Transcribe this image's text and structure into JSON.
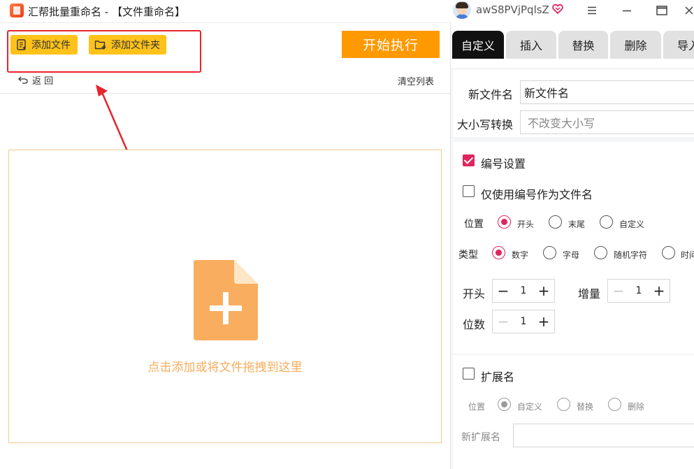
{
  "window": {
    "title": "汇帮批量重命名 - 【文件重命名】",
    "username": "awS8PVjPqlsZ"
  },
  "toolbar": {
    "add_file": "添加文件",
    "add_folder": "添加文件夹",
    "start": "开始执行",
    "back": "返 回",
    "clear_list": "清空列表"
  },
  "dropzone": {
    "text": "点击添加或将文件拖拽到这里"
  },
  "tabs": [
    {
      "label": "自定义",
      "active": true
    },
    {
      "label": "插入"
    },
    {
      "label": "替换"
    },
    {
      "label": "删除"
    },
    {
      "label": "导入"
    }
  ],
  "rename": {
    "new_name_label": "新文件名",
    "new_name_value": "新文件名",
    "case_label": "大小写转换",
    "case_value": "不改变大小写"
  },
  "numbering": {
    "settings_label": "编号设置",
    "settings_checked": true,
    "only_number_label": "仅使用编号作为文件名",
    "only_number_checked": false,
    "position_label": "位置",
    "position_options": [
      "开头",
      "末尾",
      "自定义"
    ],
    "position_selected": "开头",
    "type_label": "类型",
    "type_options": [
      "数字",
      "字母",
      "随机字符",
      "时间"
    ],
    "type_selected": "数字",
    "start_label": "开头",
    "start_value": "1",
    "increment_label": "增量",
    "increment_value": "1",
    "digits_label": "位数",
    "digits_value": "1"
  },
  "extension": {
    "label": "扩展名",
    "checked": false,
    "position_label": "位置",
    "position_options": [
      "自定义",
      "替换",
      "删除"
    ],
    "position_selected": "自定义",
    "new_ext_label": "新扩展名",
    "new_ext_value": ""
  },
  "colors": {
    "accent_yellow": "#ffc21a",
    "start_orange": "#ff9900",
    "annotation_red": "#e8232c",
    "active_pink": "#e0245e",
    "dropzone_orange": "#f7ad5c"
  }
}
